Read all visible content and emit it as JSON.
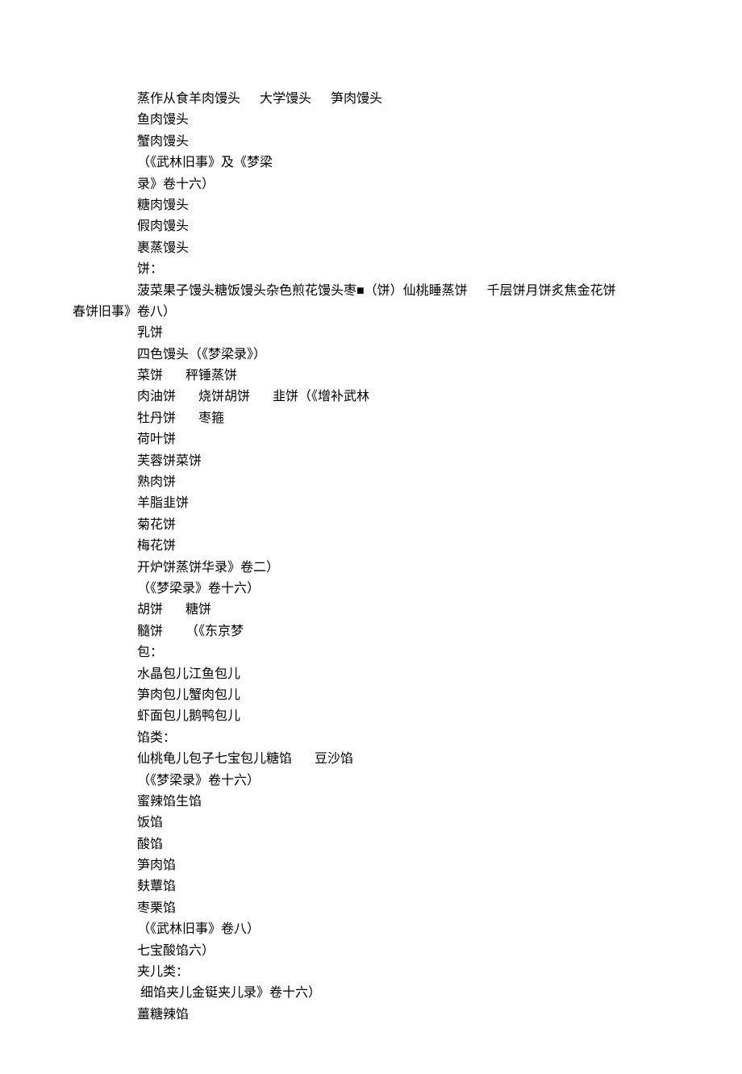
{
  "lines": [
    {
      "text": "蒸作从食羊肉馒头      大学馒头      笋肉馒头",
      "indent": true
    },
    {
      "text": "鱼肉馒头",
      "indent": true
    },
    {
      "text": "蟹肉馒头",
      "indent": true
    },
    {
      "text": "（《武林旧事》及《梦梁",
      "indent": true
    },
    {
      "text": "录》卷十六）",
      "indent": true
    },
    {
      "text": "糖肉馒头",
      "indent": true
    },
    {
      "text": "假肉馒头",
      "indent": true
    },
    {
      "text": "裹蒸馒头",
      "indent": true
    },
    {
      "text": "饼：",
      "indent": true
    },
    {
      "text": "菠菜果子馒头糖饭馒头杂色煎花馒头枣■（饼）仙桃睡蒸饼      千层饼月饼炙焦金花饼",
      "indent": true
    },
    {
      "text": "春饼旧事》卷八）",
      "indent": false
    },
    {
      "text": "乳饼",
      "indent": true
    },
    {
      "text": "四色馒头（《梦梁录》）",
      "indent": true
    },
    {
      "text": "菜饼       秤锤蒸饼",
      "indent": true
    },
    {
      "text": "肉油饼       烧饼胡饼       韭饼（《增补武林",
      "indent": true
    },
    {
      "text": "牡丹饼       枣箍",
      "indent": true
    },
    {
      "text": "荷叶饼",
      "indent": true
    },
    {
      "text": "芙蓉饼菜饼",
      "indent": true
    },
    {
      "text": "熟肉饼",
      "indent": true
    },
    {
      "text": "羊脂韭饼",
      "indent": true
    },
    {
      "text": "菊花饼",
      "indent": true
    },
    {
      "text": "梅花饼",
      "indent": true
    },
    {
      "text": "开炉饼蒸饼华录》卷二）",
      "indent": true
    },
    {
      "text": "（《梦梁录》卷十六）",
      "indent": true
    },
    {
      "text": "胡饼       糖饼",
      "indent": true
    },
    {
      "text": "髓饼       （《东京梦",
      "indent": true
    },
    {
      "text": "包：",
      "indent": true
    },
    {
      "text": "水晶包儿江鱼包儿",
      "indent": true
    },
    {
      "text": "笋肉包儿蟹肉包儿",
      "indent": true
    },
    {
      "text": "虾面包儿鹅鸭包儿",
      "indent": true
    },
    {
      "text": "馅类：",
      "indent": true
    },
    {
      "text": "仙桃龟儿包子七宝包儿糖馅       豆沙馅",
      "indent": true
    },
    {
      "text": "（《梦梁录》卷十六）",
      "indent": true
    },
    {
      "text": "蜜辣馅生馅",
      "indent": true
    },
    {
      "text": "饭馅",
      "indent": true
    },
    {
      "text": "酸馅",
      "indent": true
    },
    {
      "text": "笋肉馅",
      "indent": true
    },
    {
      "text": "麸蕈馅",
      "indent": true
    },
    {
      "text": "枣栗馅",
      "indent": true
    },
    {
      "text": "（《武林旧事》卷八）",
      "indent": true
    },
    {
      "text": "七宝酸馅六）",
      "indent": true
    },
    {
      "text": "夹儿类：",
      "indent": true
    },
    {
      "text": " 细馅夹儿金铤夹儿录》卷十六）",
      "indent": true
    },
    {
      "text": "薑糖辣馅",
      "indent": true
    }
  ]
}
